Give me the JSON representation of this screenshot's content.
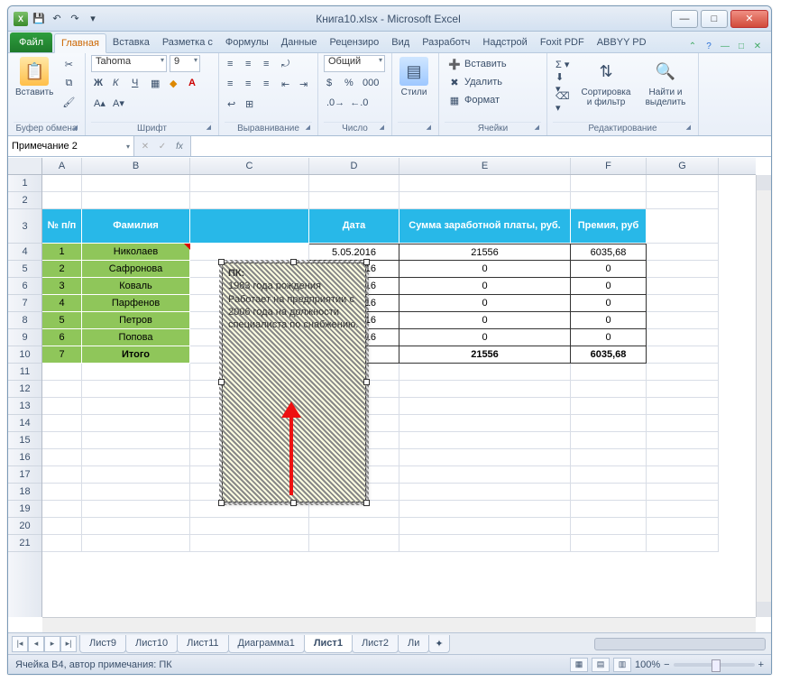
{
  "window": {
    "title_doc": "Книга10.xlsx",
    "title_app": "Microsoft Excel"
  },
  "qat": {
    "save": "💾",
    "undo": "↶",
    "redo": "↷"
  },
  "tabs": {
    "file": "Файл",
    "items": [
      "Главная",
      "Вставка",
      "Разметка с",
      "Формулы",
      "Данные",
      "Рецензиро",
      "Вид",
      "Разработч",
      "Надстрой",
      "Foxit PDF",
      "ABBYY PD"
    ],
    "active_index": 0
  },
  "ribbon": {
    "clipboard": {
      "paste": "Вставить",
      "label": "Буфер обмена"
    },
    "font": {
      "name": "Tahoma",
      "size": "9",
      "label": "Шрифт"
    },
    "align": {
      "label": "Выравнивание"
    },
    "number": {
      "format": "Общий",
      "label": "Число"
    },
    "styles": {
      "btn": "Стили",
      "label": ""
    },
    "cells": {
      "insert": "Вставить",
      "delete": "Удалить",
      "format": "Формат",
      "label": "Ячейки"
    },
    "editing": {
      "sort": "Сортировка и фильтр",
      "find": "Найти и выделить",
      "label": "Редактирование"
    }
  },
  "formula_bar": {
    "name_box": "Примечание 2",
    "fx": "fx",
    "value": ""
  },
  "columns": [
    "A",
    "B",
    "C",
    "D",
    "E",
    "F",
    "G"
  ],
  "rows_labels": [
    "1",
    "2",
    "3",
    "4",
    "5",
    "6",
    "7",
    "8",
    "9",
    "10",
    "11",
    "12",
    "13",
    "14",
    "15",
    "16",
    "17",
    "18",
    "19",
    "20",
    "21"
  ],
  "headers": {
    "a": "№ п/п",
    "b": "Фамилия",
    "d": "Дата",
    "e": "Сумма заработной платы, руб.",
    "f": "Премия, руб"
  },
  "table": [
    {
      "n": "1",
      "fam": "Николаев",
      "date": "5.05.2016",
      "sum": "21556",
      "prem": "6035,68"
    },
    {
      "n": "2",
      "fam": "Сафронова",
      "date": "5.05.2016",
      "sum": "0",
      "prem": "0"
    },
    {
      "n": "3",
      "fam": "Коваль",
      "date": "5.05.2016",
      "sum": "0",
      "prem": "0"
    },
    {
      "n": "4",
      "fam": "Парфенов",
      "date": "5.05.2016",
      "sum": "0",
      "prem": "0"
    },
    {
      "n": "5",
      "fam": "Петров",
      "date": "5.05.2016",
      "sum": "0",
      "prem": "0"
    },
    {
      "n": "6",
      "fam": "Попова",
      "date": "5.05.2016",
      "sum": "0",
      "prem": "0"
    }
  ],
  "totals": {
    "n": "7",
    "fam": "Итого",
    "sum": "21556",
    "prem": "6035,68"
  },
  "comment": {
    "author": "ПК:",
    "body": "1983 года рождения Работает на предприятии с 2006 года на должности специалиста по снабжению."
  },
  "sheets": {
    "items": [
      "Лист9",
      "Лист10",
      "Лист11",
      "Диаграмма1",
      "Лист1",
      "Лист2",
      "Ли"
    ],
    "active_index": 4
  },
  "status": {
    "text": "Ячейка B4, автор примечания: ПК",
    "zoom": "100%"
  }
}
